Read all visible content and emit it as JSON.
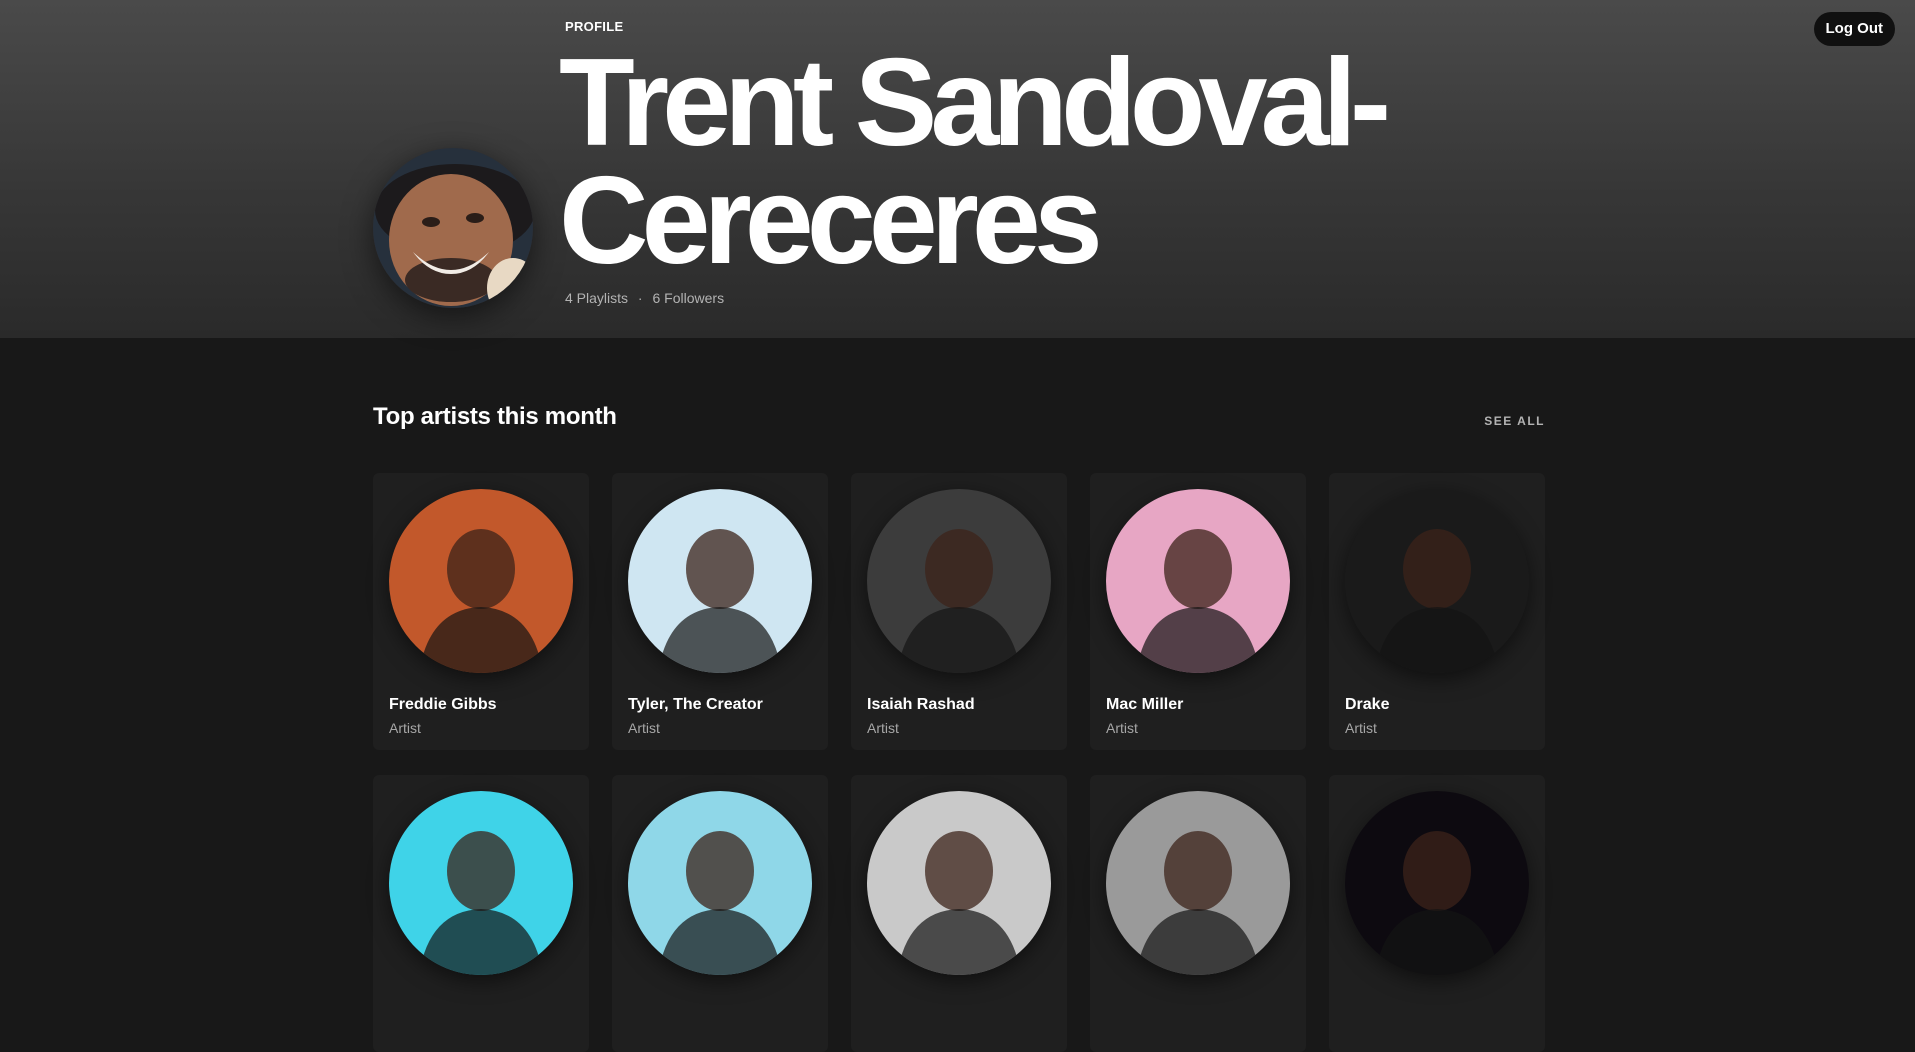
{
  "header": {
    "logout_label": "Log Out",
    "profile_label": "PROFILE",
    "name_line1": "Trent Sandoval-",
    "name_line2": "Cereceres",
    "playlists": "4 Playlists",
    "separator": "·",
    "followers": "6 Followers"
  },
  "section": {
    "title": "Top artists this month",
    "see_all": "SEE ALL"
  },
  "artists": [
    {
      "name": "Freddie Gibbs",
      "type": "Artist",
      "color": "#c2582b"
    },
    {
      "name": "Tyler, The Creator",
      "type": "Artist",
      "color": "#cfe6f2"
    },
    {
      "name": "Isaiah Rashad",
      "type": "Artist",
      "color": "#3c3c3c"
    },
    {
      "name": "Mac Miller",
      "type": "Artist",
      "color": "#e7a6c4"
    },
    {
      "name": "Drake",
      "type": "Artist",
      "color": "#1a1a1a"
    },
    {
      "name": "",
      "type": "",
      "color": "#3fd3e8"
    },
    {
      "name": "",
      "type": "",
      "color": "#8fd7e8"
    },
    {
      "name": "",
      "type": "",
      "color": "#c9c9c9"
    },
    {
      "name": "",
      "type": "",
      "color": "#9a9a9a"
    },
    {
      "name": "",
      "type": "",
      "color": "#0d0a10"
    }
  ]
}
